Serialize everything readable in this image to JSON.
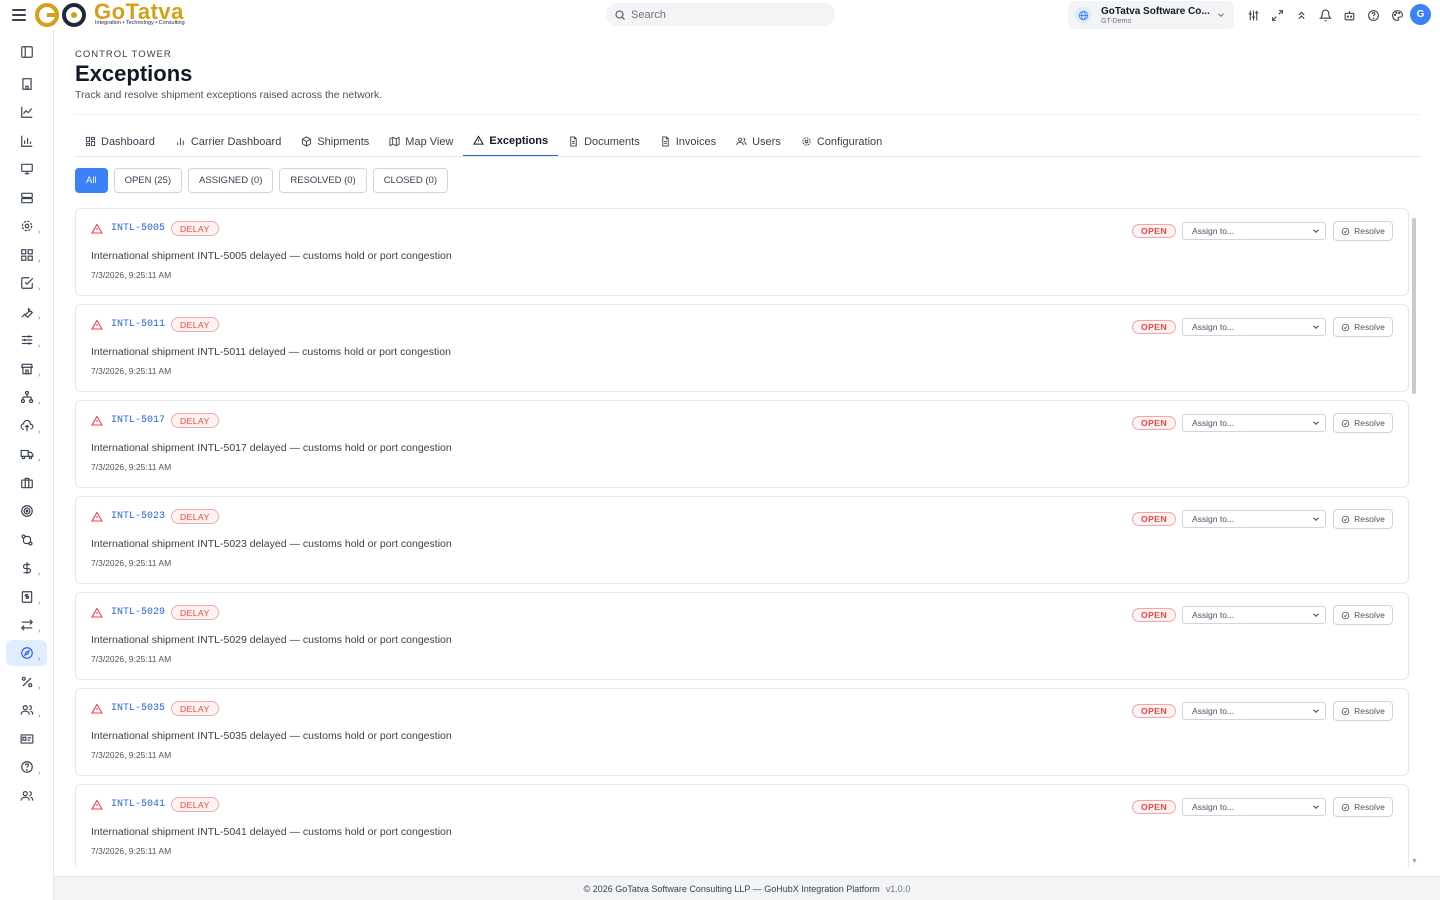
{
  "topbar": {
    "brand": "GoTatva",
    "tagline": "Integration • Technology • Consulting",
    "search_placeholder": "Search",
    "org_name": "GoTatva Software Co...",
    "org_sub": "GT-Demo",
    "avatar_initial": "G"
  },
  "page": {
    "eyebrow": "CONTROL TOWER",
    "title": "Exceptions",
    "subtitle": "Track and resolve shipment exceptions raised across the network."
  },
  "tabs": [
    {
      "label": "Dashboard"
    },
    {
      "label": "Carrier Dashboard"
    },
    {
      "label": "Shipments"
    },
    {
      "label": "Map View"
    },
    {
      "label": "Exceptions"
    },
    {
      "label": "Documents"
    },
    {
      "label": "Invoices"
    },
    {
      "label": "Users"
    },
    {
      "label": "Configuration"
    }
  ],
  "filters": [
    {
      "label": "All"
    },
    {
      "label": "OPEN (25)"
    },
    {
      "label": "ASSIGNED (0)"
    },
    {
      "label": "RESOLVED (0)"
    },
    {
      "label": "CLOSED (0)"
    }
  ],
  "exceptions": [
    {
      "code": "INTL-5005",
      "type": "DELAY",
      "description": "International shipment INTL-5005 delayed — customs hold or port congestion",
      "timestamp": "7/3/2026, 9:25:11 AM",
      "status": "OPEN",
      "assign_placeholder": "Assign to...",
      "resolve_label": "Resolve"
    },
    {
      "code": "INTL-5011",
      "type": "DELAY",
      "description": "International shipment INTL-5011 delayed — customs hold or port congestion",
      "timestamp": "7/3/2026, 9:25:11 AM",
      "status": "OPEN",
      "assign_placeholder": "Assign to...",
      "resolve_label": "Resolve"
    },
    {
      "code": "INTL-5017",
      "type": "DELAY",
      "description": "International shipment INTL-5017 delayed — customs hold or port congestion",
      "timestamp": "7/3/2026, 9:25:11 AM",
      "status": "OPEN",
      "assign_placeholder": "Assign to...",
      "resolve_label": "Resolve"
    },
    {
      "code": "INTL-5023",
      "type": "DELAY",
      "description": "International shipment INTL-5023 delayed — customs hold or port congestion",
      "timestamp": "7/3/2026, 9:25:11 AM",
      "status": "OPEN",
      "assign_placeholder": "Assign to...",
      "resolve_label": "Resolve"
    },
    {
      "code": "INTL-5029",
      "type": "DELAY",
      "description": "International shipment INTL-5029 delayed — customs hold or port congestion",
      "timestamp": "7/3/2026, 9:25:11 AM",
      "status": "OPEN",
      "assign_placeholder": "Assign to...",
      "resolve_label": "Resolve"
    },
    {
      "code": "INTL-5035",
      "type": "DELAY",
      "description": "International shipment INTL-5035 delayed — customs hold or port congestion",
      "timestamp": "7/3/2026, 9:25:11 AM",
      "status": "OPEN",
      "assign_placeholder": "Assign to...",
      "resolve_label": "Resolve"
    },
    {
      "code": "INTL-5041",
      "type": "DELAY",
      "description": "International shipment INTL-5041 delayed — customs hold or port congestion",
      "timestamp": "7/3/2026, 9:25:11 AM",
      "status": "OPEN",
      "assign_placeholder": "Assign to...",
      "resolve_label": "Resolve"
    }
  ],
  "footer": {
    "text": "© 2026 GoTatva Software Consulting LLP — GoHubX Integration Platform",
    "version": "v1.0.0"
  },
  "colors": {
    "accent": "#3b82f6",
    "danger": "#ef4444",
    "brand_gold": "#d4a017"
  }
}
